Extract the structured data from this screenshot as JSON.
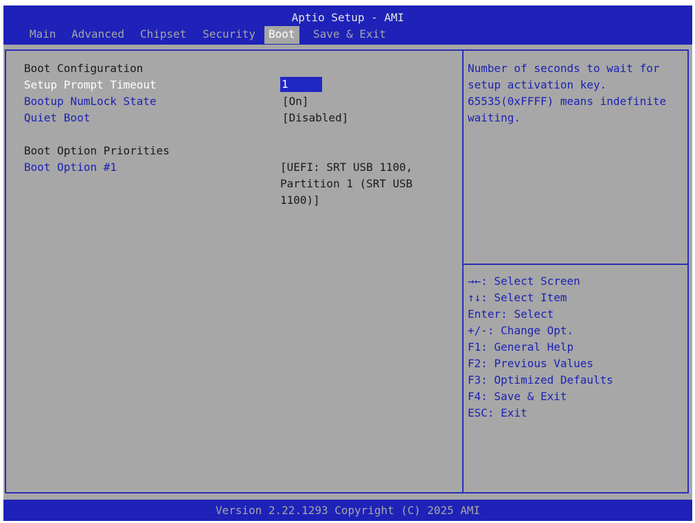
{
  "header": {
    "title": "Aptio Setup - AMI",
    "tabs": [
      {
        "label": "Main"
      },
      {
        "label": "Advanced"
      },
      {
        "label": "Chipset"
      },
      {
        "label": "Security"
      },
      {
        "label": "Boot",
        "active": true
      },
      {
        "label": "Save & Exit"
      }
    ]
  },
  "settings": {
    "boot_configuration_heading": "Boot Configuration",
    "items": [
      {
        "label": "Setup Prompt Timeout",
        "value": "1"
      },
      {
        "label": "Bootup NumLock State",
        "value": "[On]"
      },
      {
        "label": "Quiet Boot",
        "value": "[Disabled]"
      }
    ],
    "boot_priorities_heading": "Boot Option Priorities",
    "boot_option": {
      "label": "Boot Option #1",
      "value_lines": [
        "[UEFI: SRT USB 1100,",
        "Partition 1 (SRT USB",
        "1100)]"
      ]
    }
  },
  "help": {
    "lines": [
      "Number of seconds to wait for",
      "setup activation key.",
      "65535(0xFFFF) means indefinite",
      "waiting."
    ]
  },
  "keys": [
    {
      "key": "→←",
      "desc": ": Select Screen"
    },
    {
      "key": "↑↓",
      "desc": ": Select Item"
    },
    {
      "key": "Enter",
      "desc": ": Select"
    },
    {
      "key": "+/-",
      "desc": ": Change Opt."
    },
    {
      "key": "F1",
      "desc": ": General Help"
    },
    {
      "key": "F2",
      "desc": ": Previous Values"
    },
    {
      "key": "F3",
      "desc": ": Optimized Defaults"
    },
    {
      "key": "F4",
      "desc": ": Save & Exit"
    },
    {
      "key": "ESC",
      "desc": ": Exit"
    }
  ],
  "footer": {
    "version": "Version 2.22.1293 Copyright (C) 2025 AMI"
  },
  "colors": {
    "background": "#a7a7a7",
    "bar": "#1e22b8",
    "highlight": "#2127c2",
    "text_blue": "#1c22b3",
    "text_black": "#1a1a1a"
  }
}
